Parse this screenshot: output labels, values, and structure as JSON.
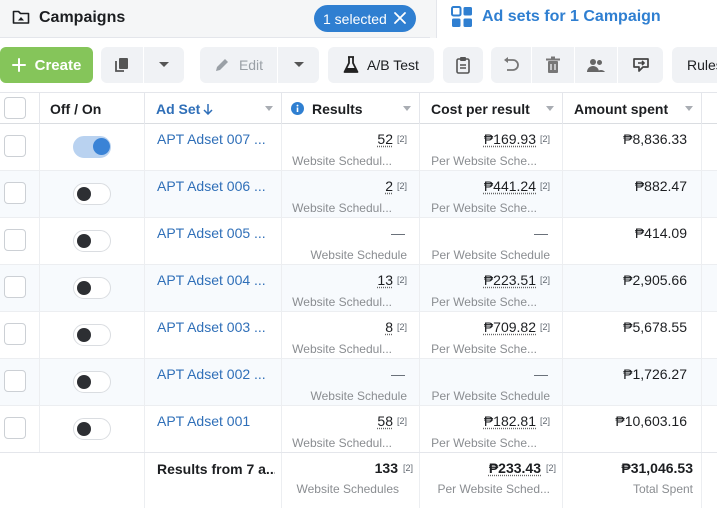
{
  "tabs": {
    "campaigns_title": "Campaigns",
    "selected_label": "1 selected",
    "adsets_title": "Ad sets for 1 Campaign"
  },
  "toolbar": {
    "create_label": "Create",
    "edit_label": "Edit",
    "ab_test_label": "A/B Test",
    "rules_label": "Rules"
  },
  "columns": {
    "off_on": "Off / On",
    "ad_set": "Ad Set",
    "results": "Results",
    "cost_per_result": "Cost per result",
    "amount_spent": "Amount spent"
  },
  "rows": [
    {
      "name": "APT Adset 007 ...",
      "on": true,
      "results": "52",
      "results_sub": "Website Schedul...",
      "cost": "₱169.93",
      "cost_sub": "Per Website Sche...",
      "spent": "₱8,836.33"
    },
    {
      "name": "APT Adset 006 ...",
      "on": false,
      "results": "2",
      "results_sub": "Website Schedul...",
      "cost": "₱441.24",
      "cost_sub": "Per Website Sche...",
      "spent": "₱882.47"
    },
    {
      "name": "APT Adset 005 ...",
      "on": false,
      "results": "—",
      "results_sub": "Website Schedule",
      "cost": "—",
      "cost_sub": "Per Website Schedule",
      "spent": "₱414.09"
    },
    {
      "name": "APT Adset 004 ...",
      "on": false,
      "results": "13",
      "results_sub": "Website Schedul...",
      "cost": "₱223.51",
      "cost_sub": "Per Website Sche...",
      "spent": "₱2,905.66"
    },
    {
      "name": "APT Adset 003 ...",
      "on": false,
      "results": "8",
      "results_sub": "Website Schedul...",
      "cost": "₱709.82",
      "cost_sub": "Per Website Sche...",
      "spent": "₱5,678.55"
    },
    {
      "name": "APT Adset 002 ...",
      "on": false,
      "results": "—",
      "results_sub": "Website Schedule",
      "cost": "—",
      "cost_sub": "Per Website Schedule",
      "spent": "₱1,726.27"
    },
    {
      "name": "APT Adset 001",
      "on": false,
      "results": "58",
      "results_sub": "Website Schedul...",
      "cost": "₱182.81",
      "cost_sub": "Per Website Sche...",
      "spent": "₱10,603.16"
    }
  ],
  "footnote_marker": "[2]",
  "footer": {
    "label": "Results from 7 a...",
    "results": "133",
    "results_sub": "Website Schedules",
    "cost": "₱233.43",
    "cost_sub": "Per Website Sched...",
    "spent": "₱31,046.53",
    "spent_sub": "Total Spent"
  },
  "colors": {
    "accent": "#2f7fd1",
    "create_green": "#85c55a",
    "link": "#2f6fb8"
  }
}
